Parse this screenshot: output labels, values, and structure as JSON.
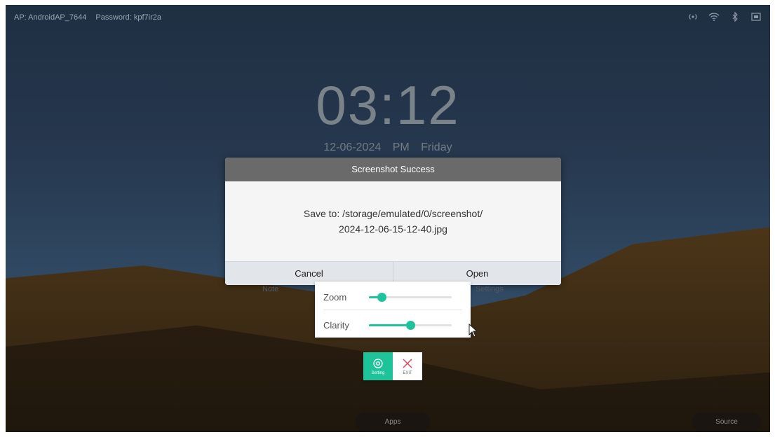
{
  "status_bar": {
    "ap": "AP: AndroidAP_7644",
    "password": "Password: kpf7ir2a",
    "icons": [
      "hotspot-icon",
      "wifi-icon",
      "bluetooth-icon",
      "screen-icon"
    ]
  },
  "home": {
    "time": "03:12",
    "date": "12-06-2024",
    "ampm": "PM",
    "weekday": "Friday",
    "note_label": "Note",
    "settings_label": "Settings",
    "apps_label": "Apps",
    "source_label": "Source"
  },
  "dialog": {
    "title": "Screenshot Success",
    "message_line1": "Save to: /storage/emulated/0/screenshot/",
    "message_line2": "2024-12-06-15-12-40.jpg",
    "cancel_label": "Cancel",
    "open_label": "Open"
  },
  "slider_panel": {
    "zoom_label": "Zoom",
    "zoom_value": 0.15,
    "clarity_label": "Clarity",
    "clarity_value": 0.5
  },
  "toolbox": {
    "setting_label": "Setting",
    "exit_label": "EXIT"
  },
  "colors": {
    "accent": "#1ec39a",
    "exit": "#e0455d",
    "dialog_title_bg": "#6a6a6a"
  }
}
